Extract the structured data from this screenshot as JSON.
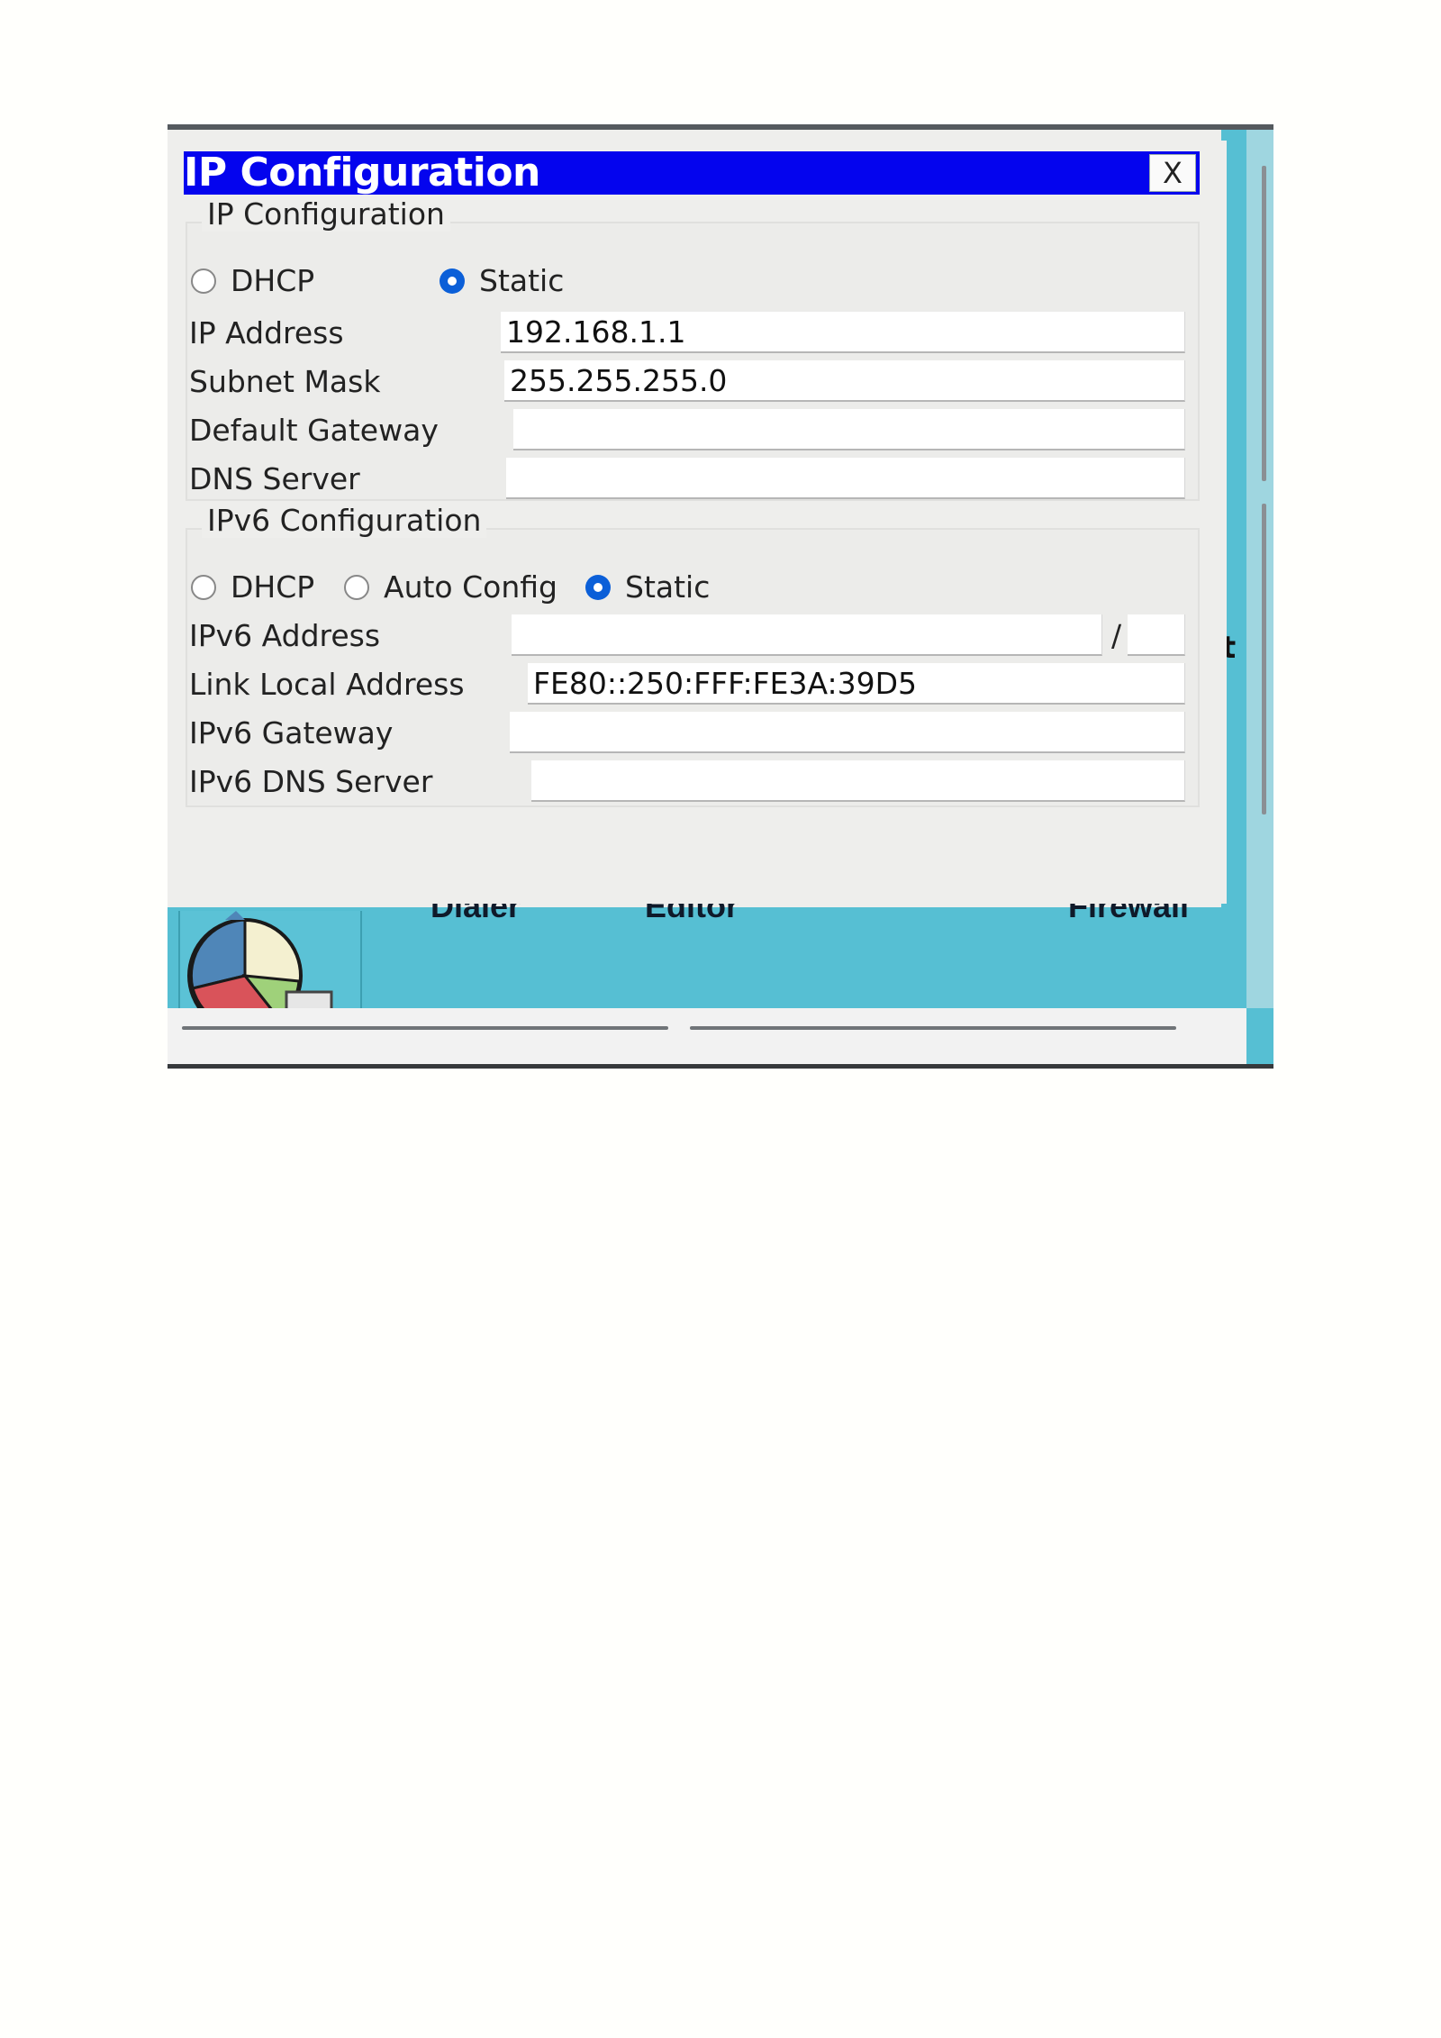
{
  "dialog": {
    "title": "IP Configuration",
    "close_label": "X"
  },
  "ipv4": {
    "legend": "IP Configuration",
    "dhcp_label": "DHCP",
    "static_label": "Static",
    "selected": "Static",
    "fields": {
      "ip_address": {
        "label": "IP Address",
        "value": "192.168.1.1"
      },
      "subnet_mask": {
        "label": "Subnet Mask",
        "value": "255.255.255.0"
      },
      "default_gateway": {
        "label": "Default Gateway",
        "value": ""
      },
      "dns_server": {
        "label": "DNS Server",
        "value": ""
      }
    }
  },
  "ipv6": {
    "legend": "IPv6 Configuration",
    "dhcp_label": "DHCP",
    "auto_config_label": "Auto Config",
    "static_label": "Static",
    "selected": "Static",
    "fields": {
      "ipv6_address": {
        "label": "IPv6 Address",
        "value": "",
        "prefix_separator": "/",
        "prefix_value": ""
      },
      "link_local_address": {
        "label": "Link Local Address",
        "value": "FE80::250:FFF:FE3A:39D5"
      },
      "ipv6_gateway": {
        "label": "IPv6 Gateway",
        "value": ""
      },
      "ipv6_dns_server": {
        "label": "IPv6 DNS Server",
        "value": ""
      }
    }
  },
  "background": {
    "side_letter": "t",
    "dock_labels": [
      "Dialer",
      "Editor",
      "Firewall"
    ],
    "colors": {
      "teal": "#56bfd3",
      "titlebar": "#0404ee",
      "radio_selected": "#0b5fd8"
    }
  }
}
